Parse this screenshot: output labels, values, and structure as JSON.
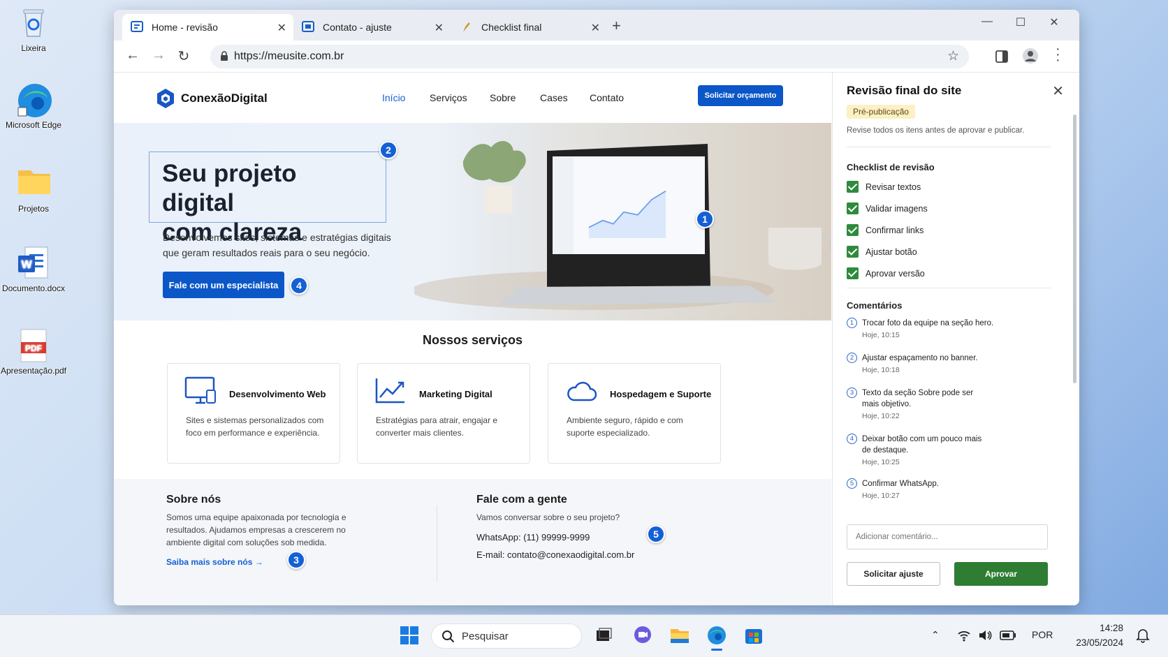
{
  "desktop": {
    "icons": [
      {
        "label": "Lixeira",
        "icon": "recycle-bin-icon"
      },
      {
        "label": "Microsoft Edge",
        "icon": "edge-icon"
      },
      {
        "label": "Projetos",
        "icon": "folder-icon"
      },
      {
        "label": "Documento.docx",
        "icon": "word-doc-icon"
      },
      {
        "label": "Apresentação.pdf",
        "icon": "pdf-icon"
      }
    ]
  },
  "browser": {
    "tabs": [
      {
        "title": "Home - revisão",
        "active": true
      },
      {
        "title": "Contato - ajuste",
        "active": false
      },
      {
        "title": "Checklist final",
        "active": false
      }
    ],
    "url": "https://meusite.com.br"
  },
  "site": {
    "logo": "ConexãoDigital",
    "nav": [
      "Início",
      "Serviços",
      "Sobre",
      "Cases",
      "Contato"
    ],
    "nav_cta": "Solicitar orçamento",
    "hero": {
      "title_line1": "Seu projeto digital",
      "title_line2": "com clareza",
      "subtitle": "Desenvolvemos sites, sistemas e estratégias digitais que geram resultados reais para o seu negócio.",
      "button": "Fale com um especialista"
    },
    "markers": [
      "1",
      "2",
      "3",
      "4",
      "5"
    ],
    "services_title": "Nossos serviços",
    "services": [
      {
        "title": "Desenvolvimento Web",
        "desc": "Sites e sistemas personalizados com foco em performance e experiência.",
        "icon": "monitor-icon"
      },
      {
        "title": "Marketing Digital",
        "desc": "Estratégias para atrair, engajar e converter mais clientes.",
        "icon": "chart-up-icon"
      },
      {
        "title": "Hospedagem e Suporte",
        "desc": "Ambiente seguro, rápido e com suporte especializado.",
        "icon": "cloud-icon"
      }
    ],
    "about": {
      "title": "Sobre nós",
      "text": "Somos uma equipe apaixonada por tecnologia e resultados. Ajudamos empresas a crescerem no ambiente digital com soluções sob medida.",
      "link": "Saiba mais sobre nós →"
    },
    "contact": {
      "title": "Fale com a gente",
      "sub": "Vamos conversar sobre o seu projeto?",
      "whatsapp": "WhatsApp: (11) 99999-9999",
      "email": "E-mail: contato@conexaodigital.com.br"
    }
  },
  "panel": {
    "title": "Revisão final do site",
    "badge": "Pré-publicação",
    "desc": "Revise todos os itens antes de aprovar e publicar.",
    "checklist_title": "Checklist de revisão",
    "checklist": [
      "Revisar textos",
      "Validar imagens",
      "Confirmar links",
      "Ajustar botão",
      "Aprovar versão"
    ],
    "comments_title": "Comentários",
    "comments": [
      {
        "n": "1",
        "text": "Trocar foto da equipe na seção hero.",
        "time": "Hoje, 10:15"
      },
      {
        "n": "2",
        "text": "Ajustar espaçamento no banner.",
        "time": "Hoje, 10:18"
      },
      {
        "n": "3",
        "text": "Texto da seção Sobre pode ser mais objetivo.",
        "time": "Hoje, 10:22"
      },
      {
        "n": "4",
        "text": "Deixar botão com um pouco mais de destaque.",
        "time": "Hoje, 10:25"
      },
      {
        "n": "5",
        "text": "Confirmar WhatsApp.",
        "time": "Hoje, 10:27"
      }
    ],
    "comment_placeholder": "Adicionar comentário...",
    "btn_adjust": "Solicitar ajuste",
    "btn_approve": "Aprovar"
  },
  "taskbar": {
    "search": "Pesquisar",
    "lang": "POR",
    "time": "14:28",
    "date": "23/05/2024"
  },
  "colors": {
    "accent": "#0b57c8",
    "approve": "#2e7d32",
    "check": "#2e8b3d",
    "badge_bg": "#fdf0c4"
  }
}
